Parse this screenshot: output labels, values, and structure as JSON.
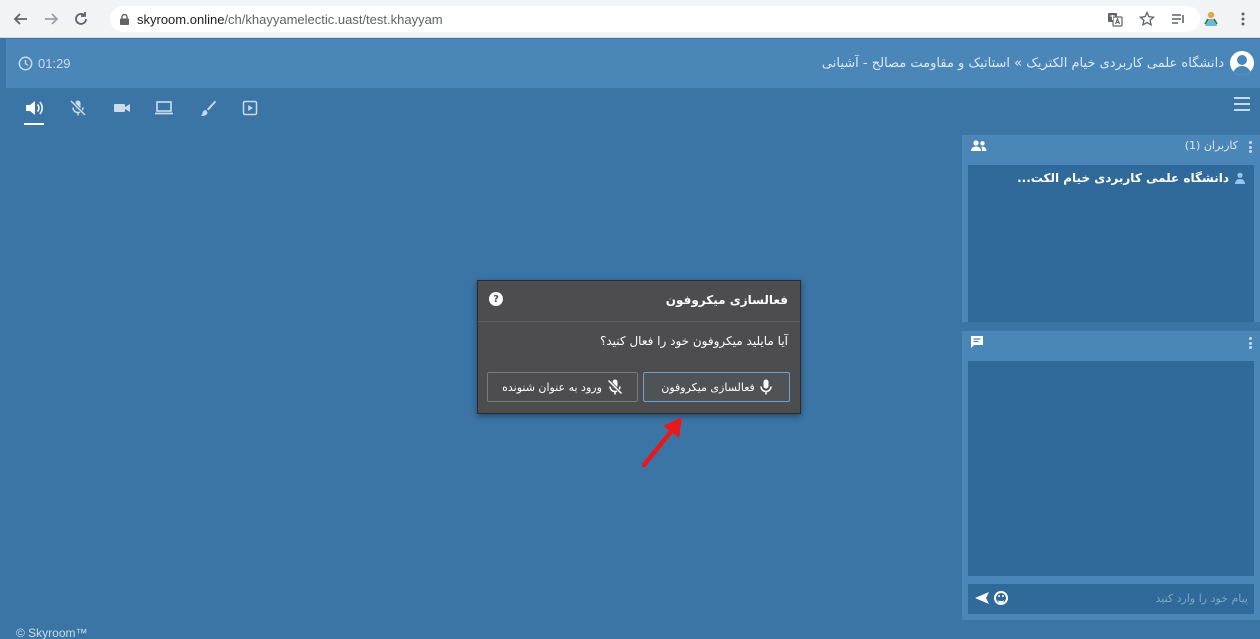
{
  "browser": {
    "url_host": "skyroom.online",
    "url_path": "/ch/khayyamelectic.uast/test.khayyam"
  },
  "header": {
    "timer": "01:29",
    "room_title": "دانشگاه علمی کاربردی خیام الکتریک » استاتیک و مقاومت مصالح - آشیانی"
  },
  "toolbar": {
    "tools": [
      "speaker-icon",
      "mic-off-icon",
      "camera-icon",
      "screen-share-icon",
      "whiteboard-icon",
      "media-play-icon"
    ],
    "active_tool": "speaker-icon"
  },
  "users_panel": {
    "title": "کاربران (1)",
    "users": [
      {
        "name": "دانشگاه علمی کاربردی خیام الکت..."
      }
    ]
  },
  "chat_panel": {
    "placeholder": "پیام خود را وارد کنید"
  },
  "dialog": {
    "title": "فعالسازی میکروفون",
    "question": "آیا مایلید میکروفون خود را فعال کنید؟",
    "activate_label": "فعالسازی میکروفون",
    "listener_label": "ورود به عنوان شنونده"
  },
  "footer": {
    "copyright": "© Skyroom™"
  },
  "colors": {
    "app_bg": "#3a75a6",
    "header_bg": "#4a86b8",
    "panel_body": "#2f6a9a",
    "dialog_bg": "#4d4d4f",
    "annotation_arrow": "#e8191c"
  }
}
